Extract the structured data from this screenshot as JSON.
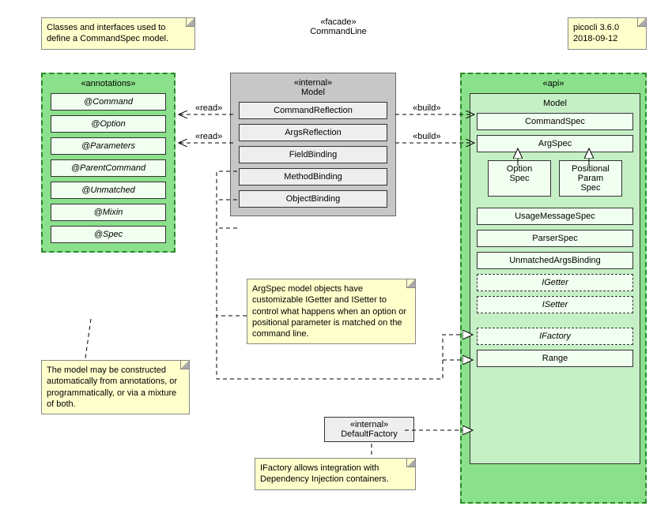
{
  "header": {
    "stereotype": "«facade»",
    "name": "CommandLine"
  },
  "version": {
    "line1": "picocli 3.6.0",
    "line2": "2018-09-12"
  },
  "notes": {
    "intro": "Classes and interfaces used to define a CommandSpec model.",
    "construct": "The model may be constructed automatically from annotations, or programmatically, or via a mixture of both.",
    "argspec": "ArgSpec model objects have customizable IGetter and ISetter to control what happens when an option or positional parameter is matched on the command line.",
    "ifactory": "IFactory allows integration with Dependency Injection containers."
  },
  "annotationsPkg": {
    "stereotype": "«annotations»",
    "items": [
      "@Command",
      "@Option",
      "@Parameters",
      "@ParentCommand",
      "@Unmatched",
      "@Mixin",
      "@Spec"
    ]
  },
  "internalPkg": {
    "stereotype": "«internal»",
    "name": "Model",
    "items": [
      "CommandReflection",
      "ArgsReflection",
      "FieldBinding",
      "MethodBinding",
      "ObjectBinding"
    ]
  },
  "apiPkg": {
    "stereotype": "«api»",
    "name": "Model",
    "commandSpec": "CommandSpec",
    "argSpec": "ArgSpec",
    "optionSpec": "Option\nSpec",
    "positionalParamSpec": "Positional\nParam\nSpec",
    "usageMessageSpec": "UsageMessageSpec",
    "parserSpec": "ParserSpec",
    "unmatchedArgsBinding": "UnmatchedArgsBinding",
    "iGetter": "IGetter",
    "iSetter": "ISetter",
    "iFactory": "IFactory",
    "range": "Range"
  },
  "defaultFactory": {
    "stereotype": "«internal»",
    "name": "DefaultFactory"
  },
  "arrows": {
    "read1": "«read»",
    "read2": "«read»",
    "build1": "«build»",
    "build2": "«build»"
  },
  "chart_data": {
    "type": "table",
    "title": "UML package diagram – picocli CommandLine Model",
    "packages": {
      "annotations": [
        "@Command",
        "@Option",
        "@Parameters",
        "@ParentCommand",
        "@Unmatched",
        "@Mixin",
        "@Spec"
      ],
      "internal.Model": [
        "CommandReflection",
        "ArgsReflection",
        "FieldBinding",
        "MethodBinding",
        "ObjectBinding"
      ],
      "api.Model": [
        "CommandSpec",
        "ArgSpec",
        "OptionSpec",
        "PositionalParamSpec",
        "UsageMessageSpec",
        "ParserSpec",
        "UnmatchedArgsBinding",
        "IGetter",
        "ISetter",
        "IFactory",
        "Range"
      ],
      "internal": [
        "DefaultFactory"
      ]
    },
    "relationships": [
      {
        "from": "CommandReflection",
        "to": "annotations",
        "type": "dependency",
        "label": "«read»"
      },
      {
        "from": "ArgsReflection",
        "to": "annotations",
        "type": "dependency",
        "label": "«read»"
      },
      {
        "from": "CommandReflection",
        "to": "CommandSpec",
        "type": "dependency",
        "label": "«build»"
      },
      {
        "from": "ArgsReflection",
        "to": "ArgSpec",
        "type": "dependency",
        "label": "«build»"
      },
      {
        "from": "OptionSpec",
        "to": "ArgSpec",
        "type": "generalization"
      },
      {
        "from": "PositionalParamSpec",
        "to": "ArgSpec",
        "type": "generalization"
      },
      {
        "from": "FieldBinding",
        "to": "IGetter",
        "type": "realization"
      },
      {
        "from": "MethodBinding",
        "to": "IGetter",
        "type": "realization"
      },
      {
        "from": "ObjectBinding",
        "to": "IGetter",
        "type": "realization"
      },
      {
        "from": "FieldBinding",
        "to": "ISetter",
        "type": "realization"
      },
      {
        "from": "MethodBinding",
        "to": "ISetter",
        "type": "realization"
      },
      {
        "from": "ObjectBinding",
        "to": "ISetter",
        "type": "realization"
      },
      {
        "from": "DefaultFactory",
        "to": "IFactory",
        "type": "realization"
      }
    ]
  }
}
